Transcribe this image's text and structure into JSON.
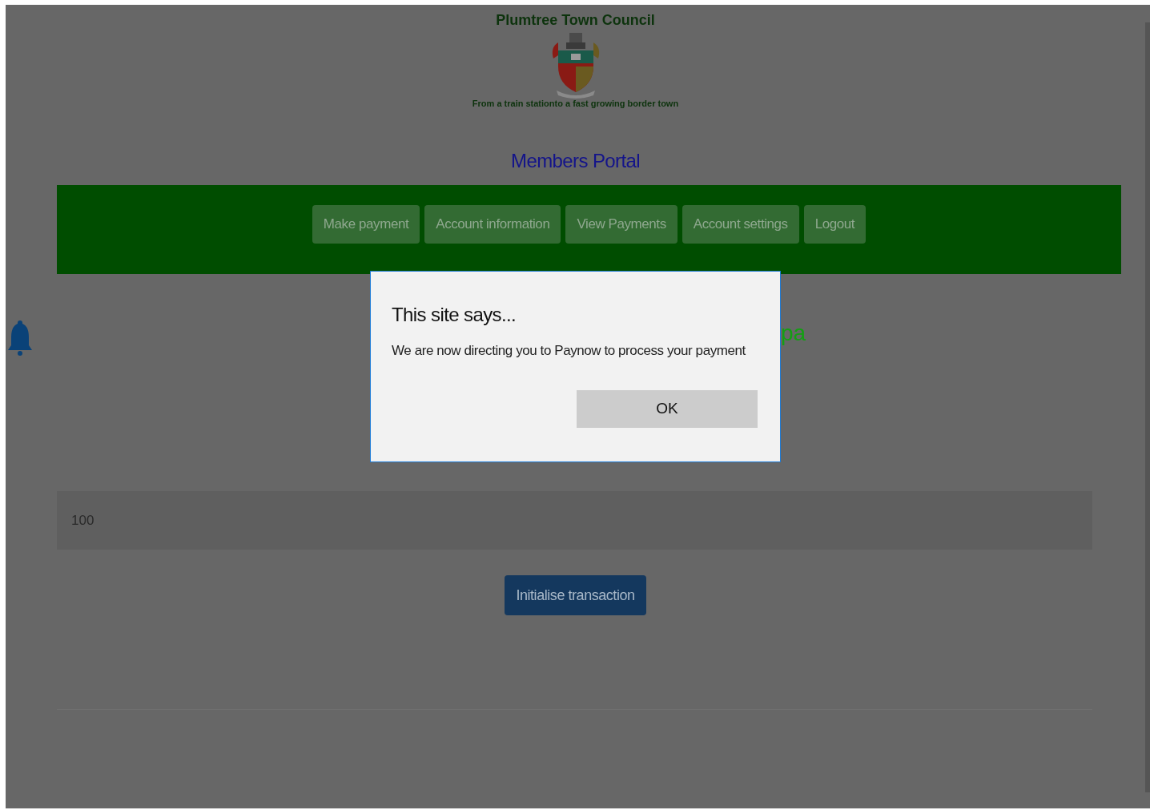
{
  "header": {
    "title": "Plumtree Town Council",
    "tagline": "From a train stationto a fast growing border town"
  },
  "portal_title": "Members Portal",
  "nav": [
    "Make payment",
    "Account information",
    "View Payments",
    "Account settings",
    "Logout"
  ],
  "heading_visible": "pa",
  "amount_field": {
    "value": "100"
  },
  "submit_button": "Initialise transaction",
  "dialog": {
    "title": "This site says...",
    "message": "We are now directing you to Paynow to process your payment",
    "ok_button": "OK"
  }
}
